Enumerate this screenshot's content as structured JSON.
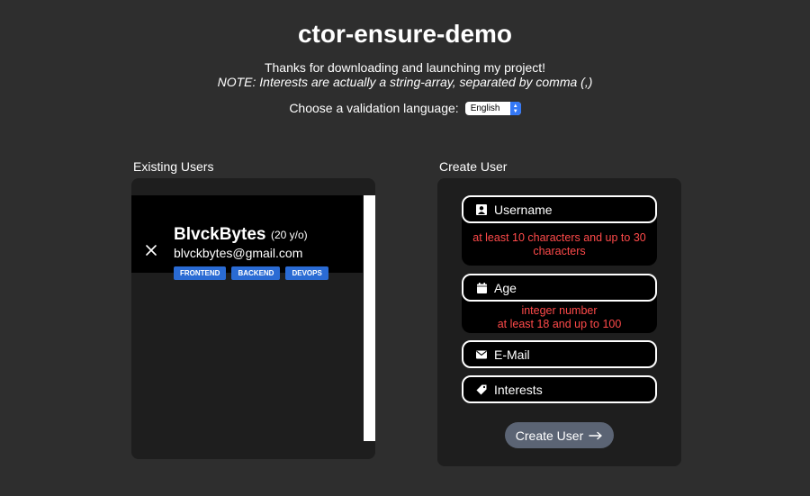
{
  "app": {
    "title": "ctor-ensure-demo",
    "intro": "Thanks for downloading and launching my project!",
    "note": "NOTE: Interests are actually a string-array, separated by comma (,)"
  },
  "language": {
    "label": "Choose a validation language:",
    "selected": "English"
  },
  "existing_users": {
    "label": "Existing Users",
    "users": [
      {
        "name": "BlvckBytes",
        "age": "(20 y/o)",
        "email": "blvckbytes@gmail.com",
        "tags": [
          "FRONTEND",
          "BACKEND",
          "DEVOPS"
        ]
      }
    ]
  },
  "create_user": {
    "label": "Create User",
    "fields": {
      "username": {
        "placeholder": "Username",
        "icon": "user-icon",
        "error": "at least 10 characters and up to 30 characters"
      },
      "age": {
        "placeholder": "Age",
        "icon": "calendar-icon",
        "error_line1": "integer number",
        "error_line2": "at least 18 and up to 100"
      },
      "email": {
        "placeholder": "E-Mail",
        "icon": "envelope-icon"
      },
      "interests": {
        "placeholder": "Interests",
        "icon": "tag-icon"
      }
    },
    "button_label": "Create User",
    "button_icon": "arrow-right-icon"
  },
  "colors": {
    "background": "#2e2e2e",
    "panel": "#1e1e1e",
    "error": "#ff4a4a",
    "tag": "#2a6bd4",
    "button": "#5b6474"
  }
}
